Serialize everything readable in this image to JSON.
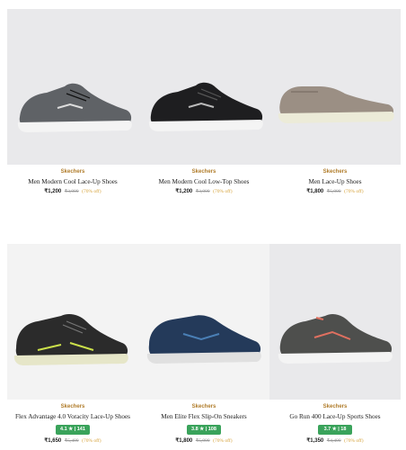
{
  "products": [
    {
      "brand": "Skechers",
      "title": "Men Modern Cool Lace-Up Shoes",
      "price": "₹1,200",
      "mrp": "₹3,999",
      "discount": "(70% off)",
      "rating": "",
      "shoe_color": "#5f6266",
      "bg": "#e9e9eb"
    },
    {
      "brand": "Skechers",
      "title": "Men Modern Cool Low-Top Shoes",
      "price": "₹1,200",
      "mrp": "₹3,999",
      "discount": "(70% off)",
      "rating": "",
      "shoe_color": "#1e1e20",
      "bg": "#e9e9eb"
    },
    {
      "brand": "Skechers",
      "title": "Men Lace-Up Shoes",
      "price": "₹1,800",
      "mrp": "₹5,999",
      "discount": "(70% off)",
      "rating": "",
      "shoe_color": "#9b8f84",
      "bg": "#e9e9eb"
    },
    {
      "brand": "Skechers",
      "title": "Flex Advantage 4.0 Voracity Lace-Up Shoes",
      "price": "₹1,650",
      "mrp": "₹5,499",
      "discount": "(70% off)",
      "rating": "4.1 ★ | 141",
      "shoe_color": "#2b2b2b",
      "bg": "#f3f3f3"
    },
    {
      "brand": "Skechers",
      "title": "Men Elite Flex Slip-On Sneakers",
      "price": "₹1,800",
      "mrp": "₹5,999",
      "discount": "(70% off)",
      "rating": "3.8 ★ | 108",
      "shoe_color": "#243a5a",
      "bg": "#f3f3f3"
    },
    {
      "brand": "Skechers",
      "title": "Go Run 400 Lace-Up Sports Shoes",
      "price": "₹1,350",
      "mrp": "₹4,499",
      "discount": "(70% off)",
      "rating": "3.7 ★ | 18",
      "shoe_color": "#4e4f4d",
      "bg": "#e9e9eb"
    }
  ]
}
